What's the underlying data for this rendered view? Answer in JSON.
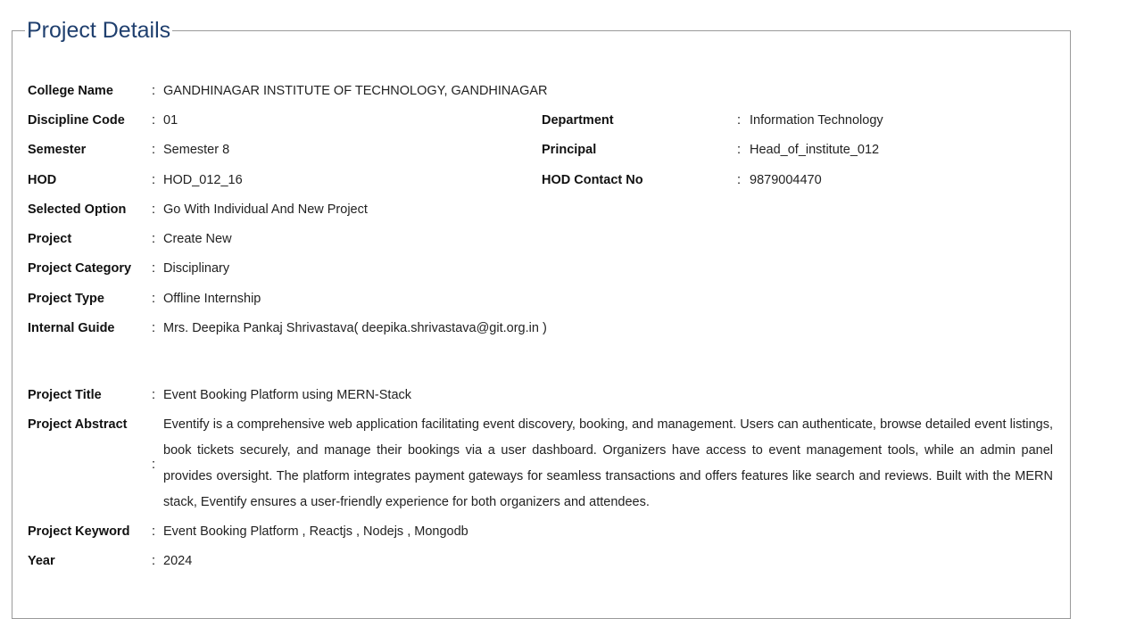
{
  "section": {
    "title": "Project Details"
  },
  "fields": {
    "college_name": {
      "label": "College Name",
      "value": "GANDHINAGAR INSTITUTE OF TECHNOLOGY, GANDHINAGAR"
    },
    "discipline_code": {
      "label": "Discipline Code",
      "value": "01"
    },
    "department": {
      "label": "Department",
      "value": "Information Technology"
    },
    "semester": {
      "label": "Semester",
      "value": "Semester 8"
    },
    "principal": {
      "label": "Principal",
      "value": "Head_of_institute_012"
    },
    "hod": {
      "label": "HOD",
      "value": "HOD_012_16"
    },
    "hod_contact": {
      "label": "HOD Contact No",
      "value": "9879004470"
    },
    "selected_option": {
      "label": "Selected Option",
      "value": "Go With Individual And New Project"
    },
    "project": {
      "label": "Project",
      "value": "Create New"
    },
    "project_category": {
      "label": "Project Category",
      "value": "Disciplinary"
    },
    "project_type": {
      "label": "Project Type",
      "value": "Offline Internship"
    },
    "internal_guide": {
      "label": "Internal Guide",
      "value": "Mrs. Deepika Pankaj Shrivastava( deepika.shrivastava@git.org.in )"
    },
    "project_title": {
      "label": "Project Title",
      "value": "Event Booking Platform using MERN-Stack"
    },
    "project_abstract": {
      "label": "Project Abstract",
      "value": "Eventify is a comprehensive web application facilitating event discovery, booking, and management. Users can authenticate, browse detailed event listings, book tickets securely, and manage their bookings via a user dashboard. Organizers have access to event management tools, while an admin panel provides oversight. The platform integrates payment gateways for seamless transactions and offers features like search and reviews. Built with the MERN stack, Eventify ensures a user-friendly experience for both organizers and attendees."
    },
    "project_keyword": {
      "label": "Project Keyword",
      "value": "Event Booking Platform , Reactjs , Nodejs , Mongodb"
    },
    "year": {
      "label": "Year",
      "value": "2024"
    }
  },
  "separator": ":"
}
